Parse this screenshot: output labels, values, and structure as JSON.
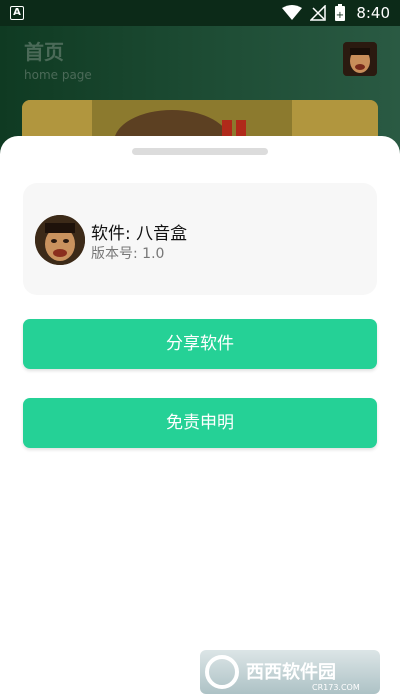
{
  "status_bar": {
    "left_badge": "A",
    "time": "8:40",
    "battery_symbol": "+"
  },
  "background_page": {
    "title": "首页",
    "subtitle": "home page"
  },
  "sheet": {
    "app_name": "软件: 八音盒",
    "app_version": "版本号: 1.0",
    "share_button": "分享软件",
    "disclaimer_button": "免责申明"
  },
  "watermark": {
    "brand": "西西软件园",
    "url": "CR173.COM"
  },
  "colors": {
    "accent": "#25d196",
    "sheet_bg": "#ffffff",
    "card_bg": "#f7f7f7"
  }
}
